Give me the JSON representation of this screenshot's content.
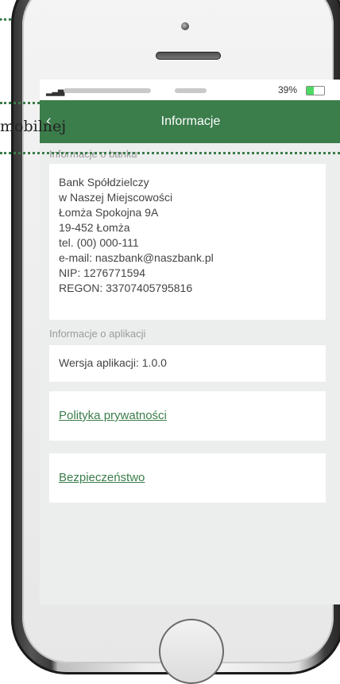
{
  "status_bar": {
    "battery_percent": "39%",
    "battery_level": 0.39
  },
  "header": {
    "title": "Informacje"
  },
  "callout": {
    "text": "mobilnej"
  },
  "bank_section": {
    "label": "Informacje o banku",
    "lines": [
      "Bank Spółdzielczy",
      "w Naszej Miejscowości",
      "Łomża Spokojna 9A",
      "19-452 Łomża",
      "tel. (00) 000-111",
      "e-mail: naszbank@naszbank.pl",
      "NIP: 1276771594",
      "REGON: 33707405795816"
    ]
  },
  "app_section": {
    "label": "Informacje o aplikacji",
    "version": "Wersja aplikacji: 1.0.0"
  },
  "links": {
    "privacy": "Polityka prywatności",
    "security": "Bezpieczeństwo"
  },
  "colors": {
    "header_green": "#3b7d4b",
    "link_green": "#3b7d4b"
  }
}
